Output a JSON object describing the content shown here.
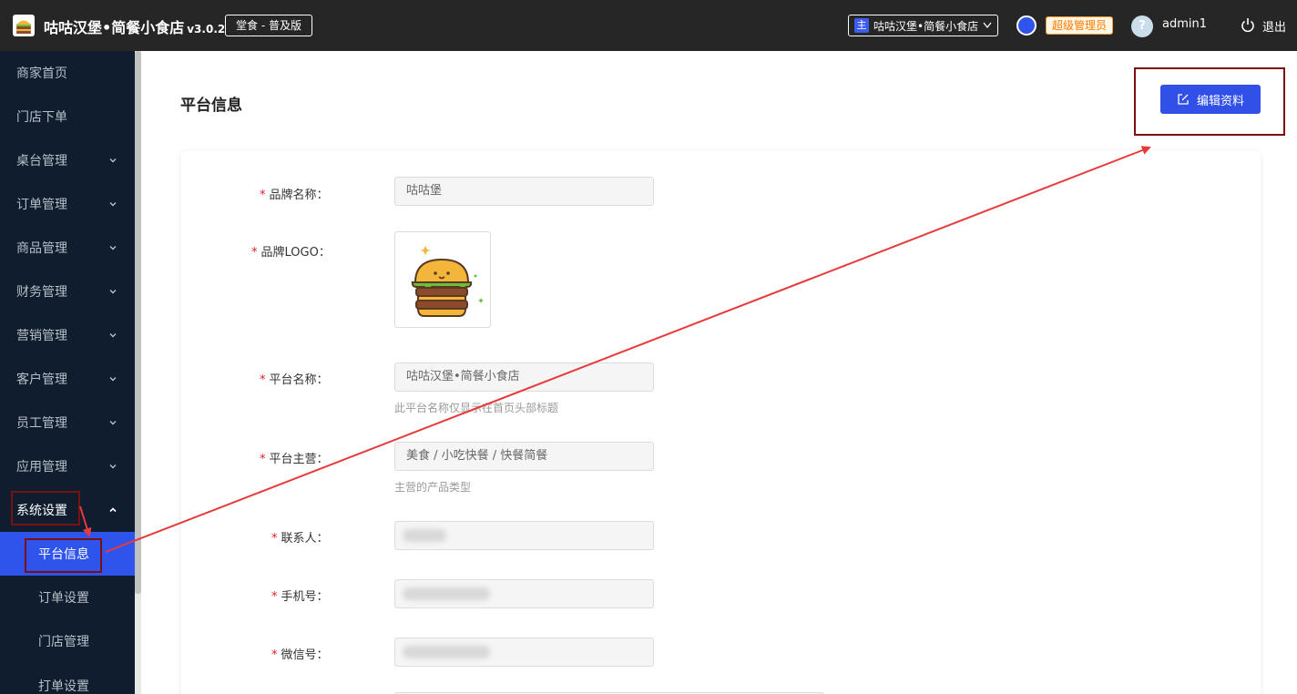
{
  "header": {
    "app_title": "咕咕汉堡•简餐小食店",
    "version": "v3.0.2",
    "edition": "堂食 - 普及版",
    "store_tag": "主",
    "store_name": "咕咕汉堡•简餐小食店",
    "role": "超级管理员",
    "avatar_glyph": "?",
    "username": "admin1",
    "logout": "退出"
  },
  "sidebar": {
    "items": [
      {
        "label": "商家首页"
      },
      {
        "label": "门店下单"
      },
      {
        "label": "桌台管理"
      },
      {
        "label": "订单管理"
      },
      {
        "label": "商品管理"
      },
      {
        "label": "财务管理"
      },
      {
        "label": "营销管理"
      },
      {
        "label": "客户管理"
      },
      {
        "label": "员工管理"
      },
      {
        "label": "应用管理"
      },
      {
        "label": "系统设置"
      }
    ],
    "sub_items": [
      {
        "label": "平台信息"
      },
      {
        "label": "订单设置"
      },
      {
        "label": "门店管理"
      },
      {
        "label": "打单设置"
      }
    ]
  },
  "main": {
    "title": "平台信息",
    "edit_button": "编辑资料"
  },
  "form": {
    "brand_name": {
      "label": "品牌名称：",
      "value": "咕咕堡"
    },
    "brand_logo": {
      "label": "品牌LOGO："
    },
    "platform_name": {
      "label": "平台名称：",
      "value": "咕咕汉堡•简餐小食店",
      "hint": "此平台名称仅显示在首页头部标题"
    },
    "platform_main": {
      "label": "平台主营：",
      "value": "美食 / 小吃快餐 / 快餐简餐",
      "hint": "主营的产品类型"
    },
    "contact": {
      "label": "联系人："
    },
    "phone": {
      "label": "手机号："
    },
    "wechat": {
      "label": "微信号："
    }
  },
  "colors": {
    "accent": "#2f54eb",
    "header_bg": "#262626",
    "sidebar_bg": "#0f1d2e",
    "annotation": "#e83a3a"
  }
}
